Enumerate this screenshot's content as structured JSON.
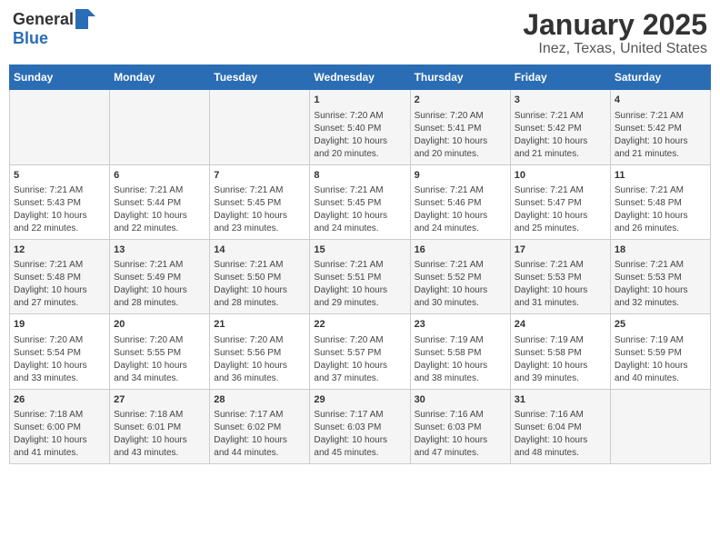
{
  "header": {
    "logo_general": "General",
    "logo_blue": "Blue",
    "title": "January 2025",
    "subtitle": "Inez, Texas, United States"
  },
  "weekdays": [
    "Sunday",
    "Monday",
    "Tuesday",
    "Wednesday",
    "Thursday",
    "Friday",
    "Saturday"
  ],
  "rows": [
    [
      {
        "day": "",
        "content": ""
      },
      {
        "day": "",
        "content": ""
      },
      {
        "day": "",
        "content": ""
      },
      {
        "day": "1",
        "content": "Sunrise: 7:20 AM\nSunset: 5:40 PM\nDaylight: 10 hours\nand 20 minutes."
      },
      {
        "day": "2",
        "content": "Sunrise: 7:20 AM\nSunset: 5:41 PM\nDaylight: 10 hours\nand 20 minutes."
      },
      {
        "day": "3",
        "content": "Sunrise: 7:21 AM\nSunset: 5:42 PM\nDaylight: 10 hours\nand 21 minutes."
      },
      {
        "day": "4",
        "content": "Sunrise: 7:21 AM\nSunset: 5:42 PM\nDaylight: 10 hours\nand 21 minutes."
      }
    ],
    [
      {
        "day": "5",
        "content": "Sunrise: 7:21 AM\nSunset: 5:43 PM\nDaylight: 10 hours\nand 22 minutes."
      },
      {
        "day": "6",
        "content": "Sunrise: 7:21 AM\nSunset: 5:44 PM\nDaylight: 10 hours\nand 22 minutes."
      },
      {
        "day": "7",
        "content": "Sunrise: 7:21 AM\nSunset: 5:45 PM\nDaylight: 10 hours\nand 23 minutes."
      },
      {
        "day": "8",
        "content": "Sunrise: 7:21 AM\nSunset: 5:45 PM\nDaylight: 10 hours\nand 24 minutes."
      },
      {
        "day": "9",
        "content": "Sunrise: 7:21 AM\nSunset: 5:46 PM\nDaylight: 10 hours\nand 24 minutes."
      },
      {
        "day": "10",
        "content": "Sunrise: 7:21 AM\nSunset: 5:47 PM\nDaylight: 10 hours\nand 25 minutes."
      },
      {
        "day": "11",
        "content": "Sunrise: 7:21 AM\nSunset: 5:48 PM\nDaylight: 10 hours\nand 26 minutes."
      }
    ],
    [
      {
        "day": "12",
        "content": "Sunrise: 7:21 AM\nSunset: 5:48 PM\nDaylight: 10 hours\nand 27 minutes."
      },
      {
        "day": "13",
        "content": "Sunrise: 7:21 AM\nSunset: 5:49 PM\nDaylight: 10 hours\nand 28 minutes."
      },
      {
        "day": "14",
        "content": "Sunrise: 7:21 AM\nSunset: 5:50 PM\nDaylight: 10 hours\nand 28 minutes."
      },
      {
        "day": "15",
        "content": "Sunrise: 7:21 AM\nSunset: 5:51 PM\nDaylight: 10 hours\nand 29 minutes."
      },
      {
        "day": "16",
        "content": "Sunrise: 7:21 AM\nSunset: 5:52 PM\nDaylight: 10 hours\nand 30 minutes."
      },
      {
        "day": "17",
        "content": "Sunrise: 7:21 AM\nSunset: 5:53 PM\nDaylight: 10 hours\nand 31 minutes."
      },
      {
        "day": "18",
        "content": "Sunrise: 7:21 AM\nSunset: 5:53 PM\nDaylight: 10 hours\nand 32 minutes."
      }
    ],
    [
      {
        "day": "19",
        "content": "Sunrise: 7:20 AM\nSunset: 5:54 PM\nDaylight: 10 hours\nand 33 minutes."
      },
      {
        "day": "20",
        "content": "Sunrise: 7:20 AM\nSunset: 5:55 PM\nDaylight: 10 hours\nand 34 minutes."
      },
      {
        "day": "21",
        "content": "Sunrise: 7:20 AM\nSunset: 5:56 PM\nDaylight: 10 hours\nand 36 minutes."
      },
      {
        "day": "22",
        "content": "Sunrise: 7:20 AM\nSunset: 5:57 PM\nDaylight: 10 hours\nand 37 minutes."
      },
      {
        "day": "23",
        "content": "Sunrise: 7:19 AM\nSunset: 5:58 PM\nDaylight: 10 hours\nand 38 minutes."
      },
      {
        "day": "24",
        "content": "Sunrise: 7:19 AM\nSunset: 5:58 PM\nDaylight: 10 hours\nand 39 minutes."
      },
      {
        "day": "25",
        "content": "Sunrise: 7:19 AM\nSunset: 5:59 PM\nDaylight: 10 hours\nand 40 minutes."
      }
    ],
    [
      {
        "day": "26",
        "content": "Sunrise: 7:18 AM\nSunset: 6:00 PM\nDaylight: 10 hours\nand 41 minutes."
      },
      {
        "day": "27",
        "content": "Sunrise: 7:18 AM\nSunset: 6:01 PM\nDaylight: 10 hours\nand 43 minutes."
      },
      {
        "day": "28",
        "content": "Sunrise: 7:17 AM\nSunset: 6:02 PM\nDaylight: 10 hours\nand 44 minutes."
      },
      {
        "day": "29",
        "content": "Sunrise: 7:17 AM\nSunset: 6:03 PM\nDaylight: 10 hours\nand 45 minutes."
      },
      {
        "day": "30",
        "content": "Sunrise: 7:16 AM\nSunset: 6:03 PM\nDaylight: 10 hours\nand 47 minutes."
      },
      {
        "day": "31",
        "content": "Sunrise: 7:16 AM\nSunset: 6:04 PM\nDaylight: 10 hours\nand 48 minutes."
      },
      {
        "day": "",
        "content": ""
      }
    ]
  ]
}
